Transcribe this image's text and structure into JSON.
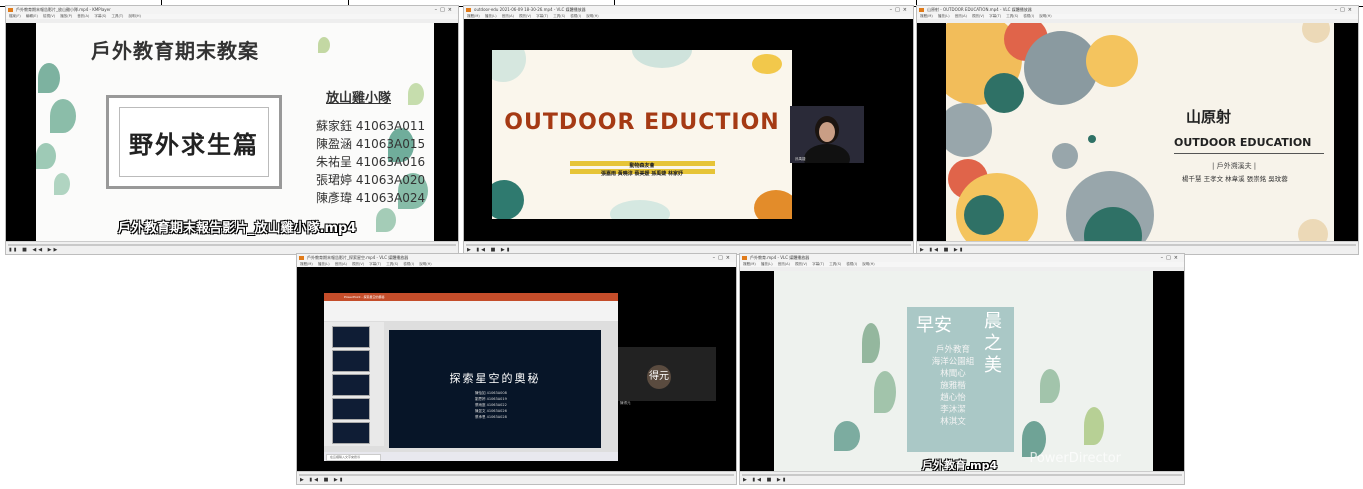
{
  "windows": {
    "w1": {
      "window_title": "戶外教育期末報告影片_放山雞小隊.mp4 - KMPlayer",
      "menu": [
        "檔案(F)",
        "編輯(E)",
        "檢視(V)",
        "播放(P)",
        "音訊(A)",
        "字幕(S)",
        "工具(T)",
        "說明(H)"
      ],
      "slide": {
        "title": "戶外教育期末教案",
        "team": "放山雞小隊",
        "frame_text": "野外求生篇",
        "members": [
          "蘇家鈺 41063A011",
          "陳盈涵 41063A015",
          "朱祐呈 41063A016",
          "張珺婷 41063A020",
          "陳彥瑋 41063A024"
        ]
      },
      "caption": "戶外教育期末報告影片_放山雞小隊.mp4"
    },
    "w2": {
      "window_title": "outdoor-edu 2021-06-09 18-30-26.mp4 - VLC 媒體播放器",
      "menu": [
        "媒體(M)",
        "播放(L)",
        "音訊(A)",
        "視訊(V)",
        "字幕(T)",
        "工具(S)",
        "檢視(I)",
        "說明(H)"
      ],
      "slide": {
        "title": "OUTDOOR EDUCTION",
        "group": "動物森友會",
        "names": "張嘉雨 黃曉淳 蔡美媛 孫禹婕 林家妤"
      },
      "cam_name": "孫禹婕"
    },
    "w3": {
      "window_title": "山原射 - OUTDOOR EDUCATION.mp4 - VLC 媒體播放器",
      "menu": [
        "媒體(M)",
        "播放(L)",
        "音訊(A)",
        "視訊(V)",
        "字幕(T)",
        "工具(S)",
        "檢視(I)",
        "說明(H)"
      ],
      "slide": {
        "title": "山原射",
        "subtitle": "OUTDOOR EDUCATION",
        "category": "| 戶外溯溪夫 |",
        "names": "楊千慧 王孝文 林韋溪 張崇銘 吳玟蓉"
      }
    },
    "w4": {
      "window_title": "戶外教育期末報告影片_探索星空.mp4 - VLC 媒體播放器",
      "menu": [
        "媒體(M)",
        "播放(L)",
        "音訊(A)",
        "視訊(V)",
        "字幕(T)",
        "工具(S)",
        "檢視(I)",
        "說明(H)"
      ],
      "ppt_title": "PowerPoint - 探索星空的奧秘",
      "slide": {
        "title": "探索星空的奧秘",
        "names": [
          "陳怡如 41063A008",
          "劉思婷 41063A019",
          "蔡雨庭 41063A022",
          "陳昱文 41063A026",
          "蔡承恩 41063A028"
        ]
      },
      "search_placeholder": "在這裡輸入文字來搜尋",
      "avatar_text": "得元",
      "avatar_name": "陳得元"
    },
    "w5": {
      "window_title": "戶外教育.mp4 - VLC 媒體播放器",
      "menu": [
        "媒體(M)",
        "播放(L)",
        "音訊(A)",
        "視訊(V)",
        "字幕(T)",
        "工具(S)",
        "檢視(I)",
        "說明(H)"
      ],
      "slide": {
        "left_word": "早安",
        "right_word": "晨之美",
        "names": [
          "戶外教育",
          "海洋公園組",
          "林聞心",
          "施雅楷",
          "趙心怡",
          "李沐潔",
          "林淇文"
        ]
      },
      "caption": "戶外教育.mp4",
      "watermark": "PowerDirector"
    }
  }
}
